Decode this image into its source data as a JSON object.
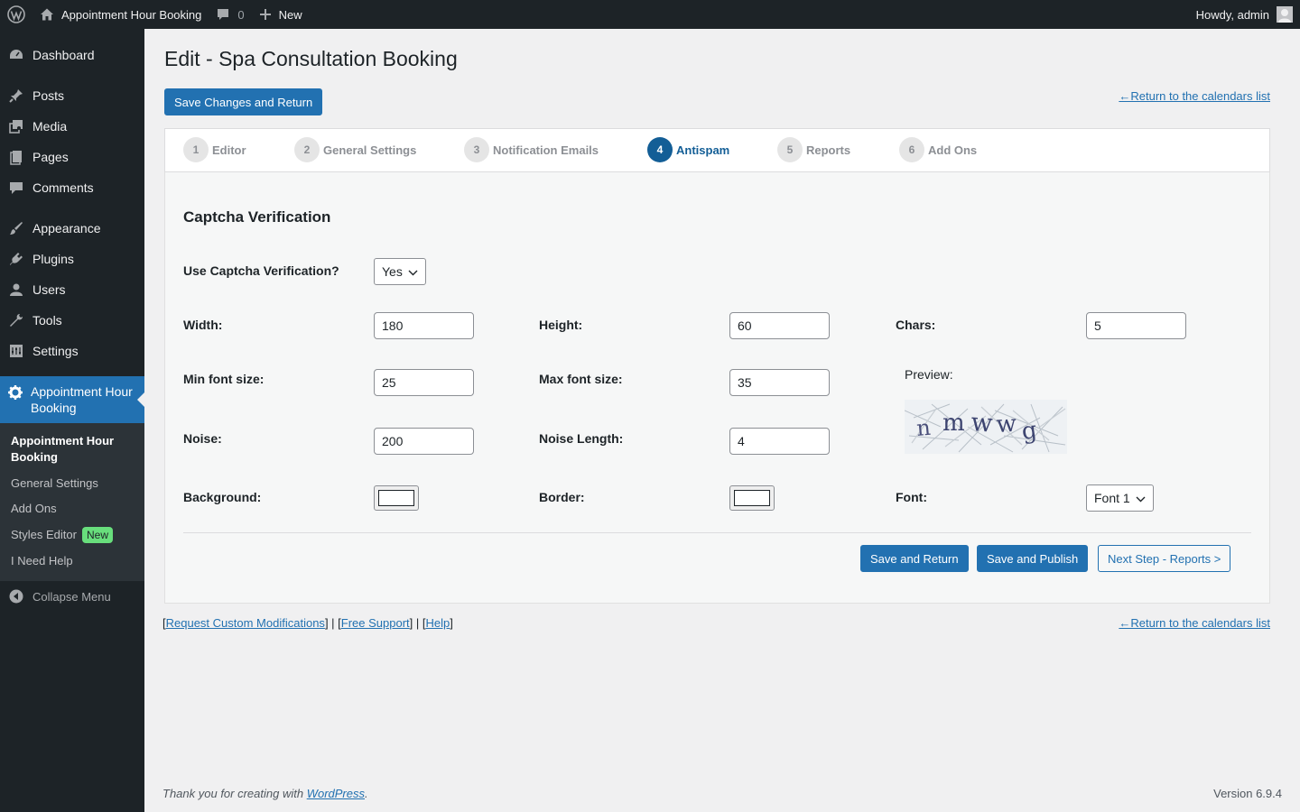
{
  "admin_bar": {
    "site_name": "Appointment Hour Booking",
    "comments_count": "0",
    "new_label": "New",
    "greeting": "Howdy, admin"
  },
  "sidebar": {
    "items": [
      {
        "label": "Dashboard",
        "icon": "dashboard-icon"
      },
      {
        "label": "Posts",
        "icon": "pin-icon"
      },
      {
        "label": "Media",
        "icon": "media-icon"
      },
      {
        "label": "Pages",
        "icon": "pages-icon"
      },
      {
        "label": "Comments",
        "icon": "comment-icon"
      },
      {
        "label": "Appearance",
        "icon": "brush-icon"
      },
      {
        "label": "Plugins",
        "icon": "plugin-icon"
      },
      {
        "label": "Users",
        "icon": "user-icon"
      },
      {
        "label": "Tools",
        "icon": "wrench-icon"
      },
      {
        "label": "Settings",
        "icon": "settings-icon"
      }
    ],
    "current": {
      "label": "Appointment Hour Booking",
      "icon": "gear-icon"
    },
    "submenu": {
      "head": "Appointment Hour Booking",
      "general": "General Settings",
      "addons": "Add Ons",
      "styles": "Styles Editor",
      "styles_badge": "New",
      "help": "I Need Help"
    },
    "collapse": "Collapse Menu"
  },
  "page": {
    "title": "Edit - Spa Consultation Booking",
    "save_return_top": "Save Changes and Return",
    "return_link": "←Return to the calendars list"
  },
  "tabs": [
    {
      "num": "1",
      "label": "Editor"
    },
    {
      "num": "2",
      "label": "General Settings"
    },
    {
      "num": "3",
      "label": "Notification Emails"
    },
    {
      "num": "4",
      "label": "Antispam"
    },
    {
      "num": "5",
      "label": "Reports"
    },
    {
      "num": "6",
      "label": "Add Ons"
    }
  ],
  "captcha": {
    "heading": "Captcha Verification",
    "use_label": "Use Captcha Verification?",
    "use_value": "Yes",
    "width_label": "Width:",
    "width_value": "180",
    "height_label": "Height:",
    "height_value": "60",
    "chars_label": "Chars:",
    "chars_value": "5",
    "min_font_label": "Min font size:",
    "min_font_value": "25",
    "max_font_label": "Max font size:",
    "max_font_value": "35",
    "preview_label": "Preview:",
    "preview_text": "nmwwg",
    "noise_label": "Noise:",
    "noise_value": "200",
    "noise_length_label": "Noise Length:",
    "noise_length_value": "4",
    "background_label": "Background:",
    "background_color": "#ffffff",
    "border_label": "Border:",
    "border_color": "#ffffff",
    "font_label": "Font:",
    "font_value": "Font 1"
  },
  "actions": {
    "save_return": "Save and Return",
    "save_publish": "Save and Publish",
    "next_step": "Next Step - Reports >"
  },
  "footer": {
    "custom_mod": "Request Custom Modifications",
    "free_support": "Free Support",
    "help": "Help",
    "return_link": "←Return to the calendars list",
    "thanks": "Thank you for creating with ",
    "wordpress": "WordPress",
    "version": "Version 6.9.4"
  },
  "colors": {
    "primary": "#2271b1",
    "active_tab": "#135e96",
    "sidebar_bg": "#1d2327",
    "badge_new": "#68de7c"
  }
}
